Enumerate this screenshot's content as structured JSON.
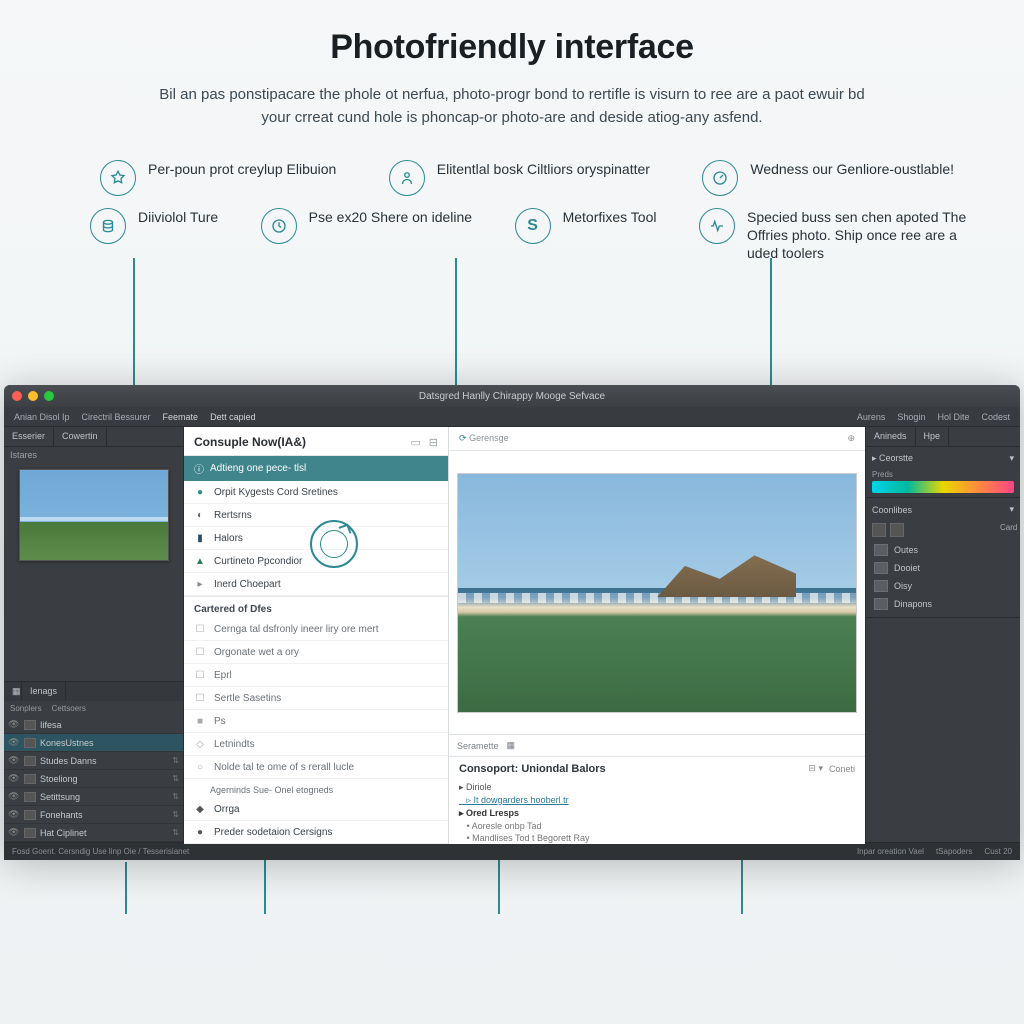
{
  "hero": {
    "title": "Photofriendly interface",
    "desc": "Bil an pas ponstipacare the phole ot nerfua, photo-progr bond to rertifle is visurn to ree are a paot ewuir bd your crreat cund hole is phoncap-or photo-are and deside atiog-any asfend."
  },
  "callouts_top": [
    {
      "icon": "star-icon",
      "text": "Per-poun prot creylup Elibuion"
    },
    {
      "icon": "person-icon",
      "text": "Elitentlal bosk Ciltliors oryspinatter"
    },
    {
      "icon": "gauge-icon",
      "text": "Wedness our Genliore-oustlable!"
    }
  ],
  "callouts_bottom": [
    {
      "icon": "stack-icon",
      "text": "Diiviolol Ture"
    },
    {
      "icon": "clock-icon",
      "text": "Pse ex20 Shere on ideline"
    },
    {
      "icon": "letter-s-icon",
      "text": "Metorfixes Tool"
    },
    {
      "icon": "pulse-icon",
      "text": "Specied buss sen chen apoted The Offries photo. Ship once ree are a uded toolers"
    }
  ],
  "app": {
    "title": "Datsgred Hanlly Chirappy Mooge Sefvace",
    "menu_left": [
      "Anian Disol Ip",
      "Cirectril Bessurer",
      "Feemate",
      "Dett capied"
    ],
    "menu_right": [
      "Aurens",
      "Shogin",
      "Hol Dite",
      "Codest"
    ],
    "left": {
      "nav_tabs": [
        "Esserier",
        "Cowertin"
      ],
      "nav_label": "Istares",
      "panel_tab_icon": "layers-icon",
      "panel_tab": "Ienags",
      "panel_sub": [
        "Sonplers",
        "Cettsoers"
      ],
      "layers": [
        {
          "label": "Iifesa",
          "muted": false
        },
        {
          "label": "KonesUstnes",
          "muted": false,
          "sel": true
        },
        {
          "label": "Studes Danns",
          "muted": true
        },
        {
          "label": "Stoeliong",
          "muted": true
        },
        {
          "label": "Setittsung",
          "muted": true
        },
        {
          "label": "Fonehants",
          "muted": true
        },
        {
          "label": "Hat Ciplinet",
          "muted": true
        }
      ]
    },
    "center": {
      "panel_title": "Consuple Now(IA&)",
      "selected": "Adtieng one pece- tlsl",
      "items": [
        {
          "ico": "●",
          "color": "#2c8a93",
          "label": "Orpit Kygests Cord Sretines"
        },
        {
          "ico": "◐",
          "color": "#666",
          "label": "Rertsrns"
        },
        {
          "ico": "▮",
          "color": "#2a4a6a",
          "label": "Halors"
        },
        {
          "ico": "▲",
          "color": "#2e7d5a",
          "label": "Curtineto Ppcondior"
        },
        {
          "ico": "▸",
          "color": "#888",
          "label": "Inerd Choepart"
        }
      ],
      "section1": "Cartered of Dfes",
      "subs1": [
        "Cernga tal dsfronly ineer liry ore mert",
        "Orgonate wet a ory",
        "Eprl",
        "Sertle Sasetins"
      ],
      "section2_items": [
        {
          "ico": "■",
          "label": "Ps"
        },
        {
          "ico": "◇",
          "label": "Letnindts"
        },
        {
          "ico": "○",
          "label": "Nolde tal te ome of s rerall lucle"
        }
      ],
      "footer_label": "Agerninds Sue- Onel etogneds",
      "footer_items": [
        {
          "ico": "◆",
          "label": "Orrga"
        },
        {
          "ico": "●",
          "label": "Preder sodetaion Cersigns"
        }
      ],
      "canvas_tab": "Gerensge",
      "bottom_tab": "Seramette",
      "bottom_title": "Consoport: Uniondal Balors",
      "bottom_action": "Coneti",
      "bottom_items": [
        {
          "label": "Diriole",
          "cls": ""
        },
        {
          "label": "It dowgarders hooberl tr",
          "cls": "lk"
        },
        {
          "label": "Ored Lresps",
          "cls": "b"
        },
        {
          "label": "Aoresle onbp Tad",
          "cls": "sub"
        },
        {
          "label": "Mandlises Tod t Begorett Ray",
          "cls": "sub"
        }
      ]
    },
    "right": {
      "tabs": [
        "Anineds",
        "Hpe"
      ],
      "sect1": "Ceorstte",
      "sect1_sub": "Preds",
      "sect2": "Coonlibes",
      "sect2_action": "Card",
      "items": [
        {
          "label": "Outes"
        },
        {
          "label": "Dooiet"
        },
        {
          "label": "Oisy"
        },
        {
          "label": "Dinapons"
        }
      ]
    },
    "status_left": "Fosd Goent. Cersndig Use linp Oie / Tesserisianet",
    "status_right": [
      "Inpar oreation Vael",
      "tSapoders",
      "Cust  20"
    ]
  }
}
